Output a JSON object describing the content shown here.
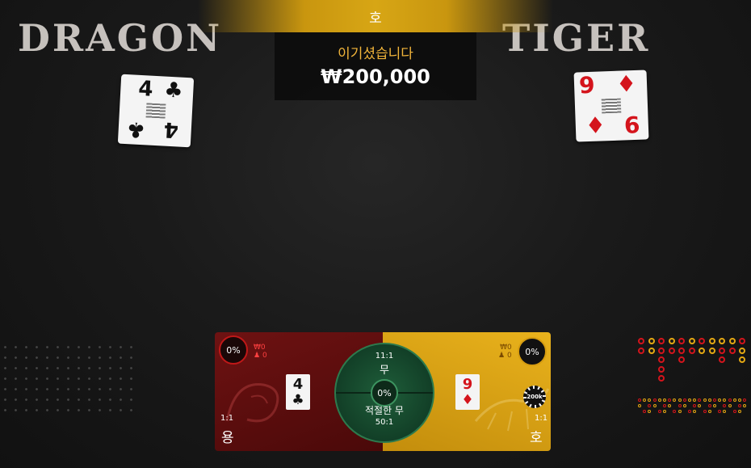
{
  "table": {
    "dragon_title": "DRAGON",
    "tiger_title": "TIGER"
  },
  "result": {
    "winner": "호",
    "win_label": "이기셨습니다",
    "win_amount": "₩200,000"
  },
  "cards": {
    "dragon": {
      "rank": "4",
      "suit": "♣",
      "color": "#111111"
    },
    "tiger": {
      "rank": "9",
      "suit": "♦",
      "color": "#d4141c"
    }
  },
  "bets": {
    "dragon": {
      "percent": "0%",
      "amount": "₩0",
      "players": "0",
      "odds": "1:1",
      "label": "용"
    },
    "tiger": {
      "percent": "0%",
      "amount": "₩0",
      "players": "0",
      "odds": "1:1",
      "label": "호",
      "chip": "200k"
    },
    "tie": {
      "odds": "11:1",
      "label": "무",
      "percent": "0%"
    },
    "suited_tie": {
      "label": "적절한 무",
      "odds": "50:1"
    }
  },
  "colors": {
    "dragon": "#d4141c",
    "tiger": "#e5a812",
    "tie": "#2ea05a"
  },
  "roadmap": {
    "bead_road": [
      [
        "D",
        "T",
        "D",
        "T",
        "D",
        "T",
        "D",
        "T",
        "T",
        "T",
        "D"
      ],
      [
        "D",
        "T",
        "D",
        "D",
        "D",
        "D",
        "T",
        "T",
        "D",
        "D",
        "T"
      ],
      [
        "",
        "",
        "D",
        "",
        "D",
        "",
        "",
        "",
        "D",
        "",
        "T"
      ],
      [
        "",
        "",
        "D",
        "",
        "",
        "",
        "",
        "",
        "",
        "",
        ""
      ],
      [
        "",
        "",
        "D",
        "",
        "",
        "",
        "",
        "",
        "",
        "",
        ""
      ]
    ]
  }
}
